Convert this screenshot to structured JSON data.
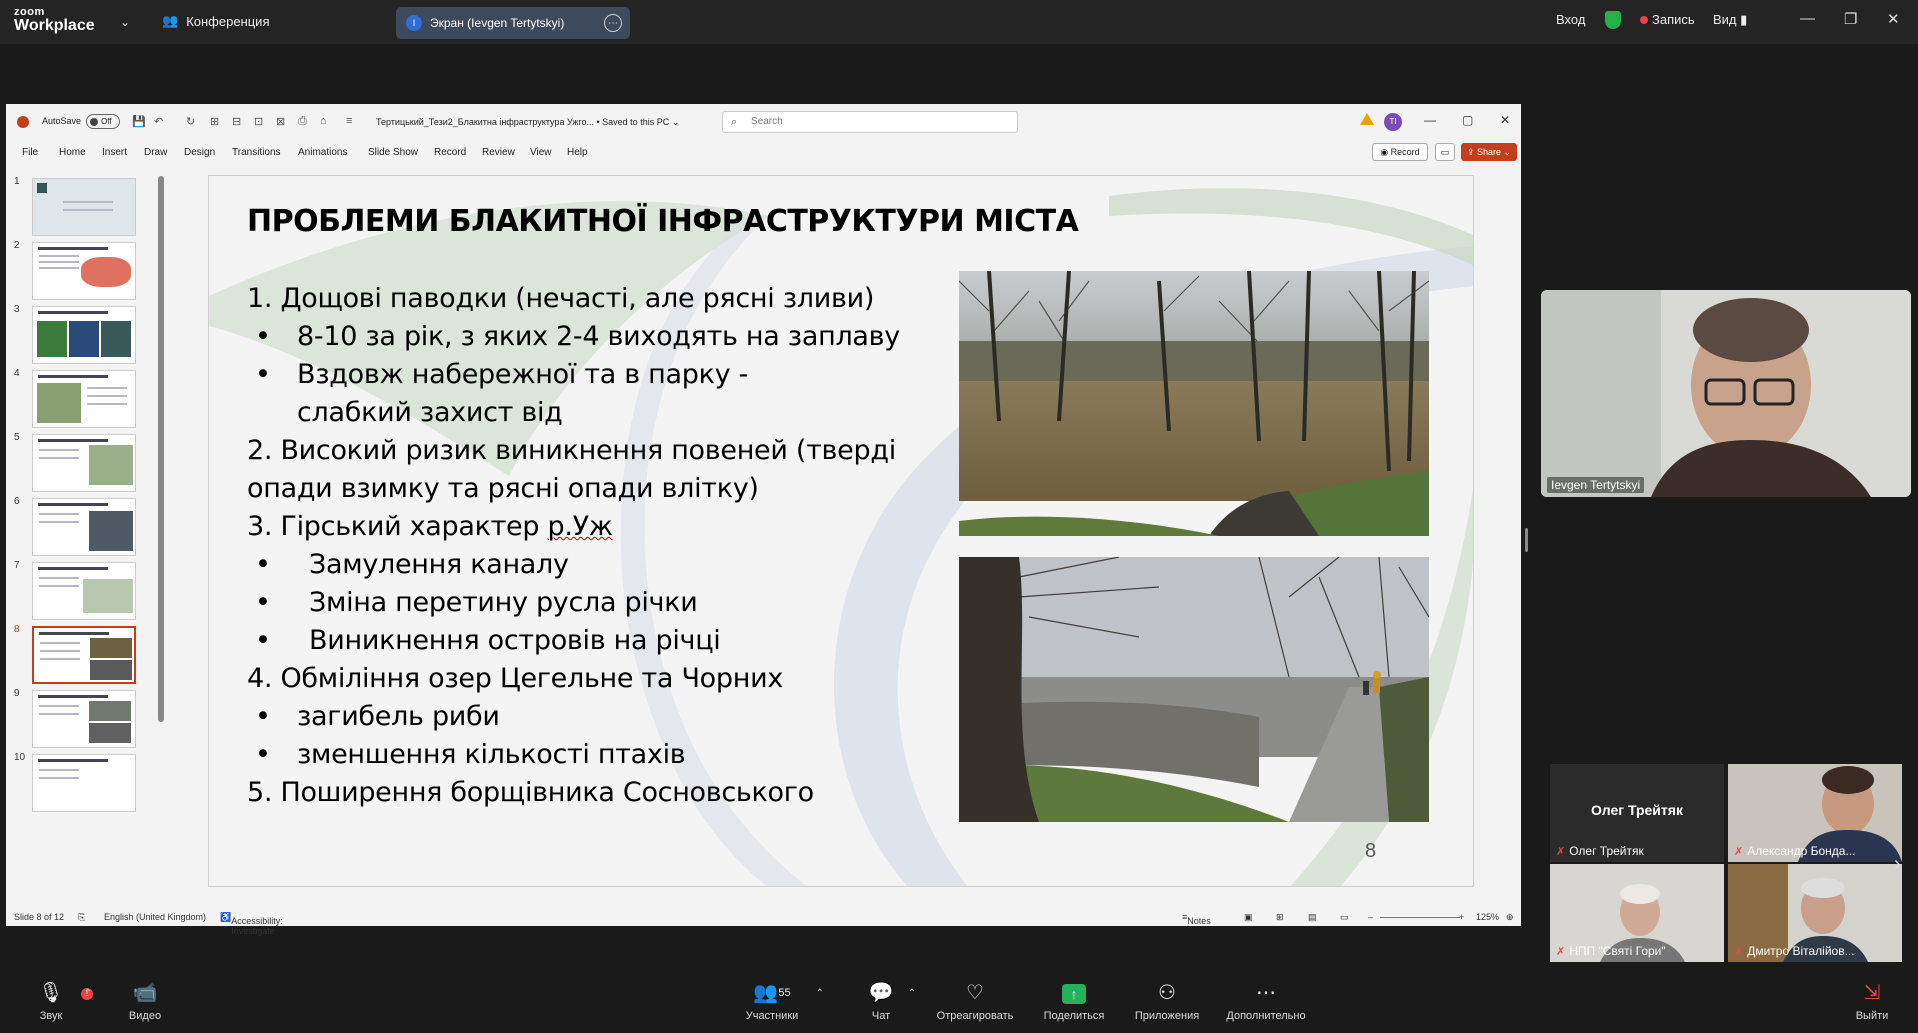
{
  "zoom": {
    "logo_line1": "zoom",
    "logo_line2": "Workplace",
    "conference_label": "Конференция",
    "screen_share_label": "Экран (Ievgen Tertytskyi)",
    "screen_share_initial": "I",
    "signin_label": "Вход",
    "record_label": "Запись",
    "view_label": "Вид"
  },
  "ppt": {
    "autosave_label": "AutoSave",
    "autosave_state": "Off",
    "doc_title": "Тертицький_Тези2_Блакитна інфраструктура Ужго...",
    "saved_label": "• Saved to this PC ⌄",
    "search_placeholder": "Search",
    "user_initials": "TI",
    "menu": [
      "File",
      "Home",
      "Insert",
      "Draw",
      "Design",
      "Transitions",
      "Animations",
      "Slide Show",
      "Record",
      "Review",
      "View",
      "Help"
    ],
    "record_button": "Record",
    "share_button": "Share",
    "thumb_numbers": [
      "1",
      "2",
      "3",
      "4",
      "5",
      "6",
      "7",
      "8",
      "9",
      "10"
    ],
    "active_slide": 8,
    "status": {
      "slide_info": "Slide 8 of 12",
      "language": "English (United Kingdom)",
      "accessibility": "Accessibility: Investigate",
      "notes": "Notes",
      "zoom": "125%"
    }
  },
  "slide": {
    "title": "ПРОБЛЕМИ БЛАКИТНОЇ ІНФРАСТРУКТУРИ МІСТА",
    "items": [
      {
        "text": "1. Дощові паводки (нечасті, але рясні зливи)"
      },
      {
        "text": "8-10 за рік, з яких 2-4 виходять на заплаву"
      },
      {
        "text": "Вздовж набережної та в парку - слабкий захист від"
      },
      {
        "text": "2. Високий ризик виникнення повеней (тверді"
      },
      {
        "text": "опади взимку та рясні опади влітку)"
      },
      {
        "text_pre": "3. Гірський характер ",
        "text_u": "р.Уж"
      },
      {
        "text": "Замулення каналу"
      },
      {
        "text": "Зміна перетину русла річки"
      },
      {
        "text": "Виникнення островів на річці"
      },
      {
        "text": "4. Обміління озер Цегельне та Чорних"
      },
      {
        "text": "загибель риби"
      },
      {
        "text": "зменшення кількості птахів"
      },
      {
        "text": "5. Поширення борщівника Сосновського"
      }
    ],
    "page_number": "8"
  },
  "participants": {
    "main_speaker": "Ievgen Tertytskyi",
    "tiles": [
      {
        "name": "Олег Трейтяк",
        "display": "Олег Трейтяк"
      },
      {
        "name": "Александр Бонда..."
      },
      {
        "name": "НПП \"Святі Гори\""
      },
      {
        "name": "Дмитро Віталійов..."
      }
    ]
  },
  "toolbar": {
    "audio": "Звук",
    "video": "Видео",
    "participants": "Участники",
    "participants_count": "55",
    "chat": "Чат",
    "react": "Отреагировать",
    "share": "Поделиться",
    "apps": "Приложения",
    "more": "Дополнительно",
    "leave": "Выйти"
  }
}
